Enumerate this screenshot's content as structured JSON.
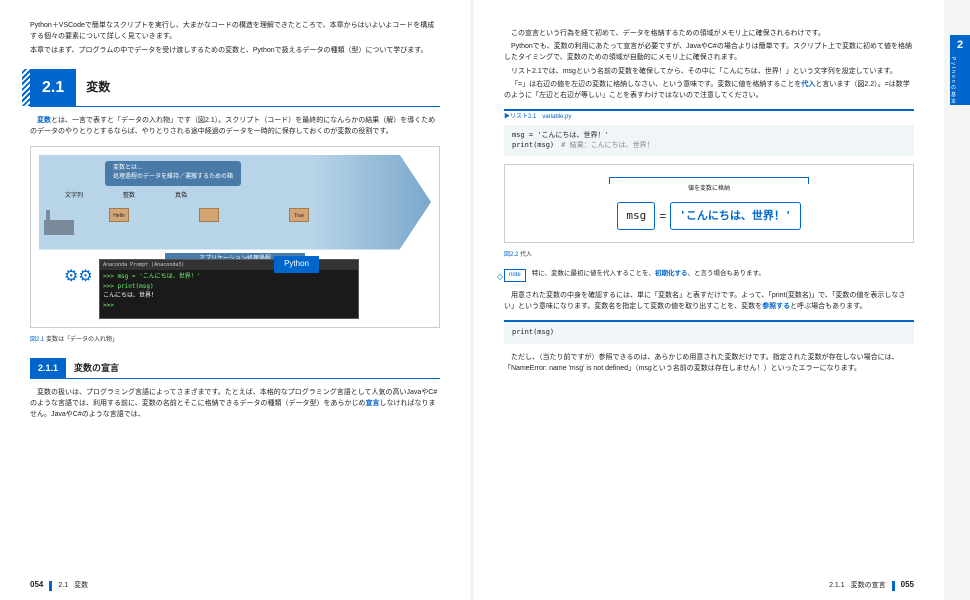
{
  "left": {
    "intro": [
      "Python＋VSCodeで簡単なスクリプトを実行し、大まかなコードの構造を理解できたところで、本章からはいよいよコードを構成する個々の要素について詳しく見ていきます。",
      "本章ではまず、プログラムの中でデータを受け渡しするための変数と、Pythonで扱えるデータの種類（型）について学びます。"
    ],
    "sec_num": "2.1",
    "sec_title": "変数",
    "body1": "とは、一言で表すと「データの入れ物」です（図2.1）。スクリプト（コード）を最終的になんらかの結果（解）を導くためのデータのやりとりとするならば、やりとりされる途中経過のデータを一時的に保存しておくのが変数の役割です。",
    "hl_var": "変数",
    "diag_label1": "変数とは…",
    "diag_label2": "処理過程のデータを維持／運搬するための箱",
    "diag_items": [
      "文字列",
      "整数",
      "真偽"
    ],
    "diag_bottom": "アプリケーション処理過程",
    "python_badge": "Python",
    "term_title": "Anaconda Prompt (Anaconda3)",
    "term_lines": [
      ">>> msg = 'こんにちは、世界！'",
      ">>> print(msg)",
      "こんにちは、世界！",
      ">>>"
    ],
    "fig_cap_num": "図2.1",
    "fig_cap_text": "変数は「データの入れ物」",
    "subsec_num": "2.1.1",
    "subsec_title": "変数の宣言",
    "body2a": "変数の扱いは、プログラミング言語によってさまざまです。たとえば、本格的なプログラミング言語として人気の高いJavaやC#のような言語では、利用する前に、変数の名前とそこに格納できるデータの種類（データ型）をあらかじめ",
    "body2_hl": "宣言",
    "body2b": "しなければなりません。JavaやC#のような言語では、"
  },
  "right": {
    "body1": [
      "この宣言という行為を経て初めて、データを格納するための領域がメモリ上に確保されるわけです。",
      "Pythonでも、変数の利用にあたって宣言が必要ですが、JavaやC#の場合よりは簡単です。スクリプト上で変数に初めて値を格納したタイミングで、変数のための領域が自動的にメモリ上に確保されます。",
      "リスト2.1では、msgという名前の変数を確保してから、その中に「こんにちは、世界！」という文字列を設定しています。"
    ],
    "body2a": "「=」は右辺の値を左辺の変数に格納しなさい、という意味です。変数に値を格納することを",
    "body2_hl": "代入",
    "body2b": "と言います（図2.2）。=は数学のように「左辺と右辺が等しい」ことを表すわけではないので注意してください。",
    "listing_label": "リスト2.1　variable.py",
    "code1_l1": "msg = 'こんにちは、世界！'",
    "code1_l2": "print(msg)",
    "code1_comment": "# 結果：こんにちは、世界！",
    "assign_label": "値を変数に格納",
    "assign_var": "msg",
    "assign_eq": "=",
    "assign_val": "'こんにちは、世界！'",
    "fig2_num": "図2.2",
    "fig2_text": "代入",
    "note_label": "note",
    "note_body_a": "特に、変数に最初に値を代入することを、",
    "note_hl": "初期化する",
    "note_body_b": "、と言う場合もあります。",
    "body3a": "用意された変数の中身を確認するには、単に「変数名」と表すだけです。よって、「print(変数名)」で、「変数の値を表示しなさい」という意味になります。変数名を指定して変数の値を取り出すことを、変数を",
    "body3_hl": "参照する",
    "body3b": "と呼ぶ場合もあります。",
    "code2": "print(msg)",
    "body4": "ただし、（当たり前ですが）参照できるのは、あらかじめ用意された変数だけです。指定された変数が存在しない場合には、「NameError: name 'msg' is not defined」（msgという名前の変数は存在しません！）といったエラーになります。",
    "tab_num": "2",
    "tab_text": "Pythonの基本"
  },
  "footer": {
    "left_num": "054",
    "left_sec": "2.1",
    "left_title": "変数",
    "right_sec": "2.1.1",
    "right_title": "変数の宣言",
    "right_num": "055"
  }
}
